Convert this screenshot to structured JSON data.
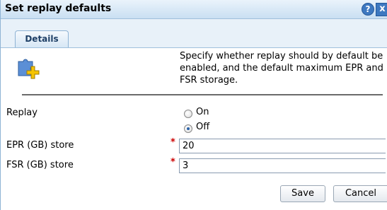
{
  "dialog": {
    "title": "Set replay defaults",
    "help_label": "?",
    "close_label": "x"
  },
  "tabs": [
    {
      "label": "Details",
      "active": true
    }
  ],
  "description": "Specify whether replay should by default be enabled, and the default maximum EPR and FSR storage.",
  "form": {
    "replay": {
      "label": "Replay",
      "options": [
        {
          "label": "On",
          "checked": false
        },
        {
          "label": "Off",
          "checked": true
        }
      ]
    },
    "epr": {
      "label": "EPR (GB) store",
      "required_mark": "*",
      "value": "20"
    },
    "fsr": {
      "label": "FSR (GB) store",
      "required_mark": "*",
      "value": "3"
    }
  },
  "buttons": {
    "save_label": "Save",
    "cancel_label": "Cancel"
  },
  "icons": {
    "plugin": "puzzle-plugin-add-icon"
  }
}
